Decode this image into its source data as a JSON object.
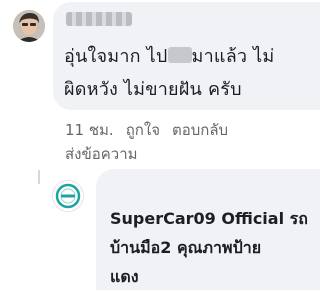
{
  "comment": {
    "text_line1_a": "อุ่นใจมาก ไป",
    "text_line1_b": "มาแล้ว ไม่",
    "text_line2": "ผิดหวัง ไม่ขายฝัน ครับ",
    "time": "11 ชม.",
    "like_label": "ถูกใจ",
    "reply_label": "ตอบกลับ",
    "message_label": "ส่งข้อความ"
  },
  "reply": {
    "author": "SuperCar09 Official",
    "text_inline": "รถ",
    "text_line2": "บ้านมือ2 คุณภาพป้าย",
    "text_line3": "แดง"
  },
  "colors": {
    "bubble": "#f0f2f5",
    "meta_text": "#65676b",
    "logo_teal": "#1fa3a0"
  }
}
